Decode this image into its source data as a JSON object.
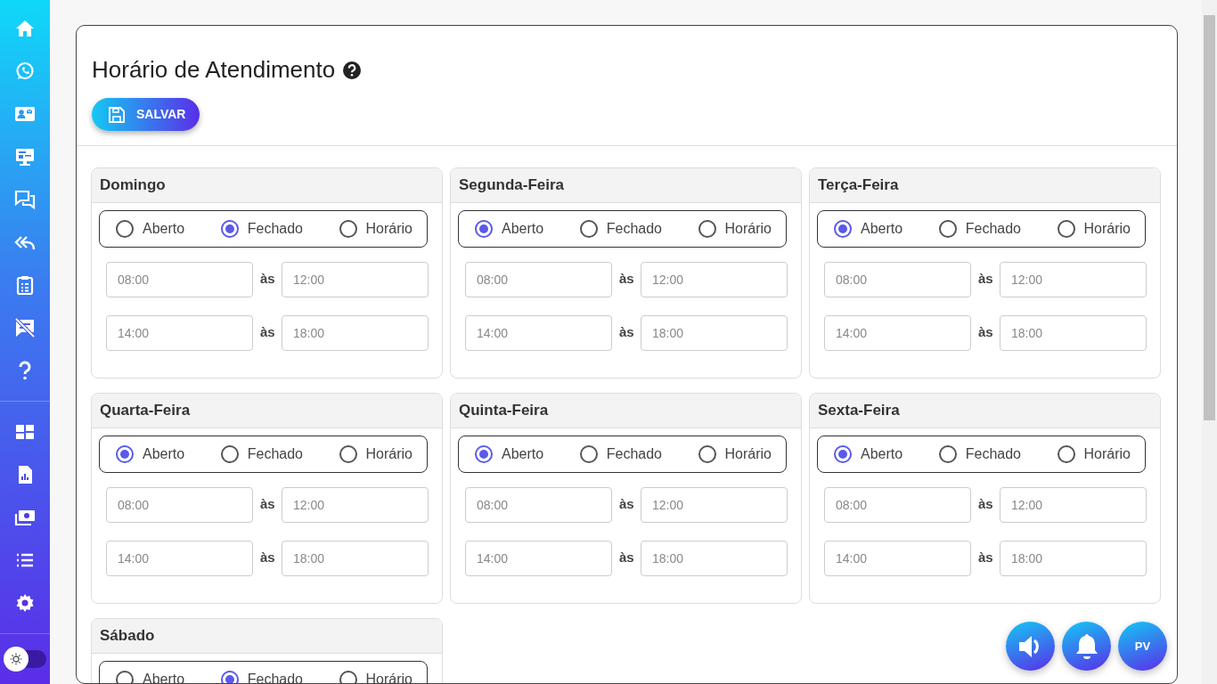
{
  "sidebar": {
    "theme_toggle": {
      "on": false
    }
  },
  "page": {
    "title": "Horário de Atendimento",
    "save_button": "SALVAR"
  },
  "days": [
    {
      "name": "Domingo",
      "options": [
        {
          "label": "Aberto",
          "selected": false
        },
        {
          "label": "Fechado",
          "selected": true
        },
        {
          "label": "Horário",
          "selected": false
        }
      ],
      "slots": [
        {
          "from": {
            "placeholder": "08:00"
          },
          "sep": "às",
          "to": {
            "placeholder": "12:00"
          }
        },
        {
          "from": {
            "placeholder": "14:00"
          },
          "sep": "às",
          "to": {
            "placeholder": "18:00"
          }
        }
      ]
    },
    {
      "name": "Segunda-Feira",
      "options": [
        {
          "label": "Aberto",
          "selected": true
        },
        {
          "label": "Fechado",
          "selected": false
        },
        {
          "label": "Horário",
          "selected": false
        }
      ],
      "slots": [
        {
          "from": {
            "placeholder": "08:00"
          },
          "sep": "às",
          "to": {
            "placeholder": "12:00"
          }
        },
        {
          "from": {
            "placeholder": "14:00"
          },
          "sep": "às",
          "to": {
            "placeholder": "18:00"
          }
        }
      ]
    },
    {
      "name": "Terça-Feira",
      "options": [
        {
          "label": "Aberto",
          "selected": true
        },
        {
          "label": "Fechado",
          "selected": false
        },
        {
          "label": "Horário",
          "selected": false
        }
      ],
      "slots": [
        {
          "from": {
            "placeholder": "08:00"
          },
          "sep": "às",
          "to": {
            "placeholder": "12:00"
          }
        },
        {
          "from": {
            "placeholder": "14:00"
          },
          "sep": "às",
          "to": {
            "placeholder": "18:00"
          }
        }
      ]
    },
    {
      "name": "Quarta-Feira",
      "options": [
        {
          "label": "Aberto",
          "selected": true
        },
        {
          "label": "Fechado",
          "selected": false
        },
        {
          "label": "Horário",
          "selected": false
        }
      ],
      "slots": [
        {
          "from": {
            "placeholder": "08:00"
          },
          "sep": "às",
          "to": {
            "placeholder": "12:00"
          }
        },
        {
          "from": {
            "placeholder": "14:00"
          },
          "sep": "às",
          "to": {
            "placeholder": "18:00"
          }
        }
      ]
    },
    {
      "name": "Quinta-Feira",
      "options": [
        {
          "label": "Aberto",
          "selected": true
        },
        {
          "label": "Fechado",
          "selected": false
        },
        {
          "label": "Horário",
          "selected": false
        }
      ],
      "slots": [
        {
          "from": {
            "placeholder": "08:00"
          },
          "sep": "às",
          "to": {
            "placeholder": "12:00"
          }
        },
        {
          "from": {
            "placeholder": "14:00"
          },
          "sep": "às",
          "to": {
            "placeholder": "18:00"
          }
        }
      ]
    },
    {
      "name": "Sexta-Feira",
      "options": [
        {
          "label": "Aberto",
          "selected": true
        },
        {
          "label": "Fechado",
          "selected": false
        },
        {
          "label": "Horário",
          "selected": false
        }
      ],
      "slots": [
        {
          "from": {
            "placeholder": "08:00"
          },
          "sep": "às",
          "to": {
            "placeholder": "12:00"
          }
        },
        {
          "from": {
            "placeholder": "14:00"
          },
          "sep": "às",
          "to": {
            "placeholder": "18:00"
          }
        }
      ]
    },
    {
      "name": "Sábado",
      "options": [
        {
          "label": "Aberto",
          "selected": false
        },
        {
          "label": "Fechado",
          "selected": true
        },
        {
          "label": "Horário",
          "selected": false
        }
      ]
    }
  ],
  "floating_buttons": [
    {
      "kind": "sound"
    },
    {
      "kind": "bell"
    },
    {
      "kind": "avatar",
      "text": "PV"
    }
  ]
}
